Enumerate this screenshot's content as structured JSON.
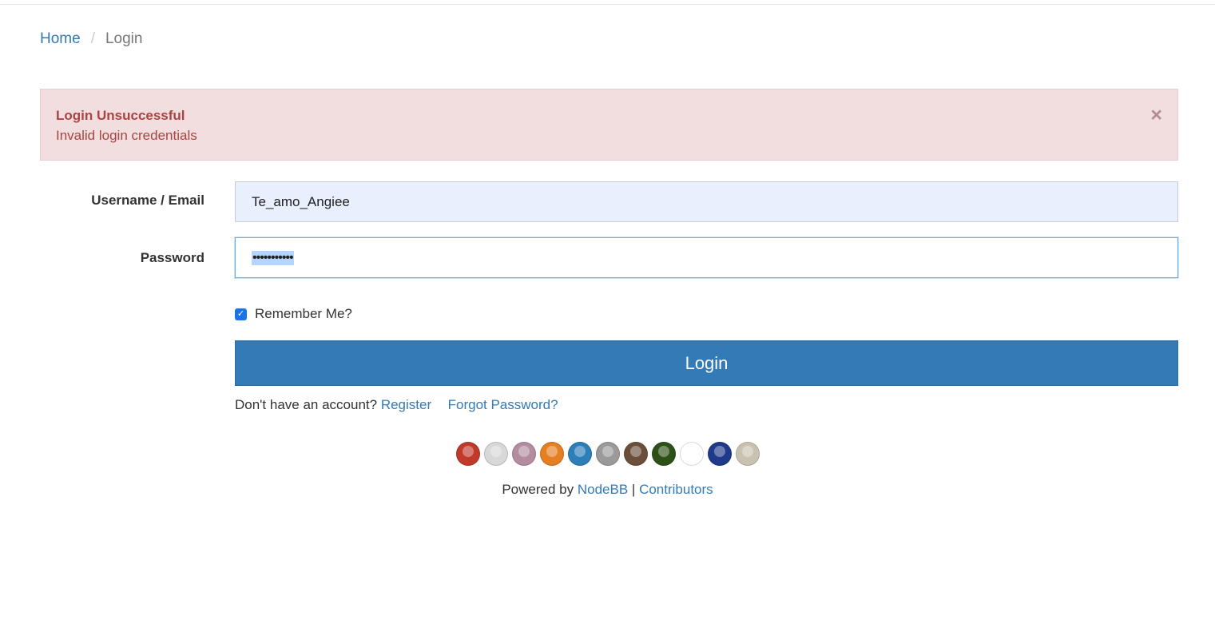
{
  "breadcrumb": {
    "home": "Home",
    "separator": "/",
    "current": "Login"
  },
  "alert": {
    "title": "Login Unsuccessful",
    "message": "Invalid login credentials",
    "close_glyph": "×"
  },
  "form": {
    "username_label": "Username / Email",
    "username_value": "Te_amo_Angiee",
    "password_label": "Password",
    "password_value": "•••••••••••",
    "remember_label": "Remember Me?",
    "remember_checked": true,
    "login_button": "Login"
  },
  "account": {
    "prompt": "Don't have an account?",
    "register": "Register",
    "forgot": "Forgot Password?"
  },
  "contributors": {
    "avatar_colors": [
      "#c0392b",
      "#d8d8d8",
      "#b48ca0",
      "#e67e22",
      "#2c7fb8",
      "#9a9a9a",
      "#6b4f3a",
      "#2d5016",
      "#ffffff",
      "#1f3a8a",
      "#c9c2b0"
    ]
  },
  "footer": {
    "powered_by": "Powered by",
    "nodebb": "NodeBB",
    "separator": "|",
    "contributors": "Contributors"
  },
  "colors": {
    "link": "#337ab7",
    "primary": "#337ab7",
    "alert_bg": "#f2dede",
    "alert_text": "#a94442"
  }
}
